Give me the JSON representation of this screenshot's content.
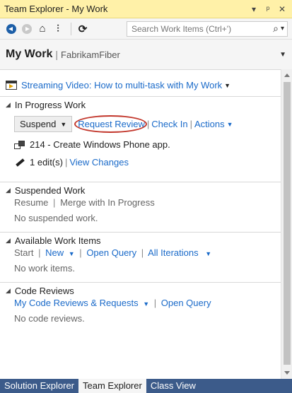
{
  "window": {
    "title": "Team Explorer - My Work",
    "controls": {
      "pin": "▾",
      "dock": "ᵖ",
      "close": "✕"
    }
  },
  "toolbar": {
    "search_placeholder": "Search Work Items (Ctrl+')",
    "search_icon": "⌕",
    "search_dropdown": "▾",
    "home_icon": "⌂",
    "connect_icon": "⫶",
    "refresh_icon": "⟳"
  },
  "header": {
    "page": "My Work",
    "separator": "|",
    "project": "FabrikamFiber",
    "caret": "▼"
  },
  "video": {
    "label": "Streaming Video: How to multi-task with My Work",
    "caret": "▼"
  },
  "in_progress": {
    "title": "In Progress Work",
    "toggle": "◢",
    "suspend_label": "Suspend",
    "request_review": "Request Review",
    "check_in": "Check In",
    "actions": "Actions",
    "dropdown": "▼",
    "bar": "|",
    "work_item": "214 - Create Windows Phone app.",
    "edits": "1 edit(s)",
    "view_changes": "View Changes"
  },
  "suspended": {
    "title": "Suspended Work",
    "toggle": "◢",
    "resume": "Resume",
    "merge": "Merge with In Progress",
    "bar": "|",
    "empty": "No suspended work."
  },
  "available": {
    "title": "Available Work Items",
    "toggle": "◢",
    "start": "Start",
    "new": "New",
    "open_query": "Open Query",
    "all_iterations": "All Iterations",
    "dropdown": "▼",
    "bar": "|",
    "empty": "No work items."
  },
  "code_reviews": {
    "title": "Code Reviews",
    "toggle": "◢",
    "my_reviews": "My Code Reviews & Requests",
    "open_query": "Open Query",
    "dropdown": "▼",
    "bar": "|",
    "empty": "No code reviews."
  },
  "tabs": [
    {
      "label": "Solution Explorer"
    },
    {
      "label": "Team Explorer"
    },
    {
      "label": "Class View"
    }
  ],
  "colors": {
    "title_bar": "#fff1a8",
    "link": "#1a6ac9",
    "tab_strip": "#3c5b8a",
    "highlight_oval": "#c2362b"
  }
}
